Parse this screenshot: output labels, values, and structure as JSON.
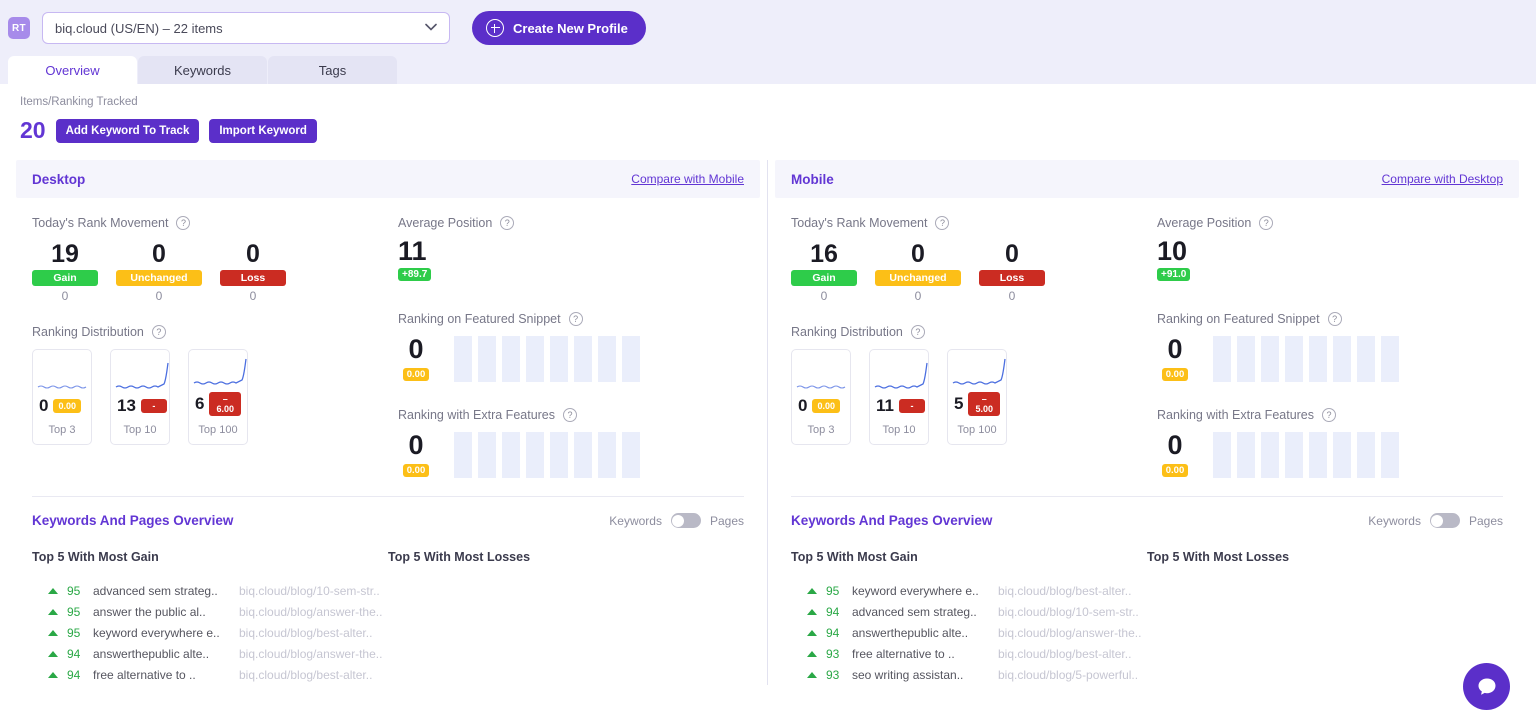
{
  "topbar": {
    "logo": "RT",
    "profile_value": "biq.cloud (US/EN) – 22 items",
    "chevron": "∨",
    "create_button": "Create New Profile"
  },
  "tabs": [
    {
      "label": "Overview",
      "active": true
    },
    {
      "label": "Keywords",
      "active": false
    },
    {
      "label": "Tags",
      "active": false
    }
  ],
  "items_tracked": {
    "label": "Items/Ranking Tracked",
    "count": "20",
    "add_keyword_button": "Add Keyword To Track",
    "import_keyword_button": "Import Keyword"
  },
  "help_glyph": "?",
  "colors": {
    "brand_purple": "#5b2fc9",
    "link_purple": "#6236d4",
    "gain_green": "#2ecc4a",
    "unchanged_yellow": "#fcbf17",
    "loss_red": "#cb2c22",
    "ghost_bar": "#eaeefb"
  },
  "panels": [
    {
      "title": "Desktop",
      "compare_link": "Compare with Mobile",
      "rank_movement": {
        "label": "Today's Rank Movement",
        "cells": [
          {
            "value": "19",
            "badge": "Gain",
            "sub": "0"
          },
          {
            "value": "0",
            "badge": "Unchanged",
            "sub": "0"
          },
          {
            "value": "0",
            "badge": "Loss",
            "sub": "0"
          }
        ]
      },
      "ranking_distribution": {
        "label": "Ranking Distribution",
        "cards": [
          {
            "value": "0",
            "badge": "0.00",
            "badge_kind": "yellow",
            "caption": "Top 3",
            "spike": false
          },
          {
            "value": "13",
            "badge": "-",
            "badge_kind": "red",
            "caption": "Top 10",
            "spike": true
          },
          {
            "value": "6",
            "badge": "–6.00",
            "badge_kind": "red",
            "caption": "Top 100",
            "spike": true
          }
        ]
      },
      "average_position": {
        "label": "Average Position",
        "value": "11",
        "badge": "+89.7"
      },
      "featured_snippet": {
        "label": "Ranking on Featured Snippet",
        "value": "0",
        "badge": "0.00"
      },
      "extra_features": {
        "label": "Ranking with Extra Features",
        "value": "0",
        "badge": "0.00"
      },
      "keywords_pages": {
        "title": "Keywords And Pages Overview",
        "toggle_left": "Keywords",
        "toggle_right": "Pages",
        "gain_header": "Top 5 With Most Gain",
        "losses_header": "Top 5 With Most Losses",
        "gain_rows": [
          {
            "score": "95",
            "keyword": "advanced sem strateg..",
            "url": "biq.cloud/blog/10-sem-str.."
          },
          {
            "score": "95",
            "keyword": "answer the public al..",
            "url": "biq.cloud/blog/answer-the.."
          },
          {
            "score": "95",
            "keyword": "keyword everywhere e..",
            "url": "biq.cloud/blog/best-alter.."
          },
          {
            "score": "94",
            "keyword": "answerthepublic alte..",
            "url": "biq.cloud/blog/answer-the.."
          },
          {
            "score": "94",
            "keyword": "free alternative to ..",
            "url": "biq.cloud/blog/best-alter.."
          }
        ],
        "loss_rows": []
      }
    },
    {
      "title": "Mobile",
      "compare_link": "Compare with Desktop",
      "rank_movement": {
        "label": "Today's Rank Movement",
        "cells": [
          {
            "value": "16",
            "badge": "Gain",
            "sub": "0"
          },
          {
            "value": "0",
            "badge": "Unchanged",
            "sub": "0"
          },
          {
            "value": "0",
            "badge": "Loss",
            "sub": "0"
          }
        ]
      },
      "ranking_distribution": {
        "label": "Ranking Distribution",
        "cards": [
          {
            "value": "0",
            "badge": "0.00",
            "badge_kind": "yellow",
            "caption": "Top 3",
            "spike": false
          },
          {
            "value": "11",
            "badge": "-",
            "badge_kind": "red",
            "caption": "Top 10",
            "spike": true
          },
          {
            "value": "5",
            "badge": "–5.00",
            "badge_kind": "red",
            "caption": "Top 100",
            "spike": true
          }
        ]
      },
      "average_position": {
        "label": "Average Position",
        "value": "10",
        "badge": "+91.0"
      },
      "featured_snippet": {
        "label": "Ranking on Featured Snippet",
        "value": "0",
        "badge": "0.00"
      },
      "extra_features": {
        "label": "Ranking with Extra Features",
        "value": "0",
        "badge": "0.00"
      },
      "keywords_pages": {
        "title": "Keywords And Pages Overview",
        "toggle_left": "Keywords",
        "toggle_right": "Pages",
        "gain_header": "Top 5 With Most Gain",
        "losses_header": "Top 5 With Most Losses",
        "gain_rows": [
          {
            "score": "95",
            "keyword": "keyword everywhere e..",
            "url": "biq.cloud/blog/best-alter.."
          },
          {
            "score": "94",
            "keyword": "advanced sem strateg..",
            "url": "biq.cloud/blog/10-sem-str.."
          },
          {
            "score": "94",
            "keyword": "answerthepublic alte..",
            "url": "biq.cloud/blog/answer-the.."
          },
          {
            "score": "93",
            "keyword": "free alternative to ..",
            "url": "biq.cloud/blog/best-alter.."
          },
          {
            "score": "93",
            "keyword": "seo writing assistan..",
            "url": "biq.cloud/blog/5-powerful.."
          }
        ],
        "loss_rows": []
      }
    }
  ],
  "chat_widget": {
    "icon": "chat-bubble-icon"
  }
}
